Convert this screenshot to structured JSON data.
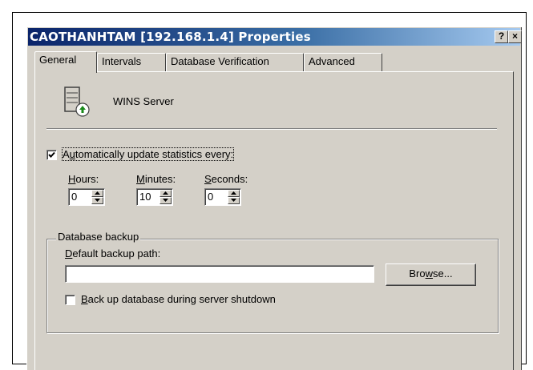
{
  "window": {
    "title": "CAOTHANHTAM [192.168.1.4] Properties",
    "help_button": "?",
    "close_button": "×"
  },
  "tabs": [
    {
      "label": "General",
      "active": true
    },
    {
      "label": "Intervals",
      "active": false
    },
    {
      "label": "Database Verification",
      "active": false
    },
    {
      "label": "Advanced",
      "active": false
    }
  ],
  "general": {
    "server_label": "WINS Server",
    "server_icon": "server-icon",
    "auto_update": {
      "checked": true,
      "label_pre": "A",
      "label_accel": "u",
      "label_post": "tomatically update statistics every:"
    },
    "hours": {
      "accel": "H",
      "rest": "ours:",
      "value": "0"
    },
    "minutes": {
      "accel": "M",
      "rest": "inutes:",
      "value": "10"
    },
    "seconds": {
      "accel": "S",
      "rest": "econds:",
      "value": "0"
    }
  },
  "database_backup": {
    "group_label": "Database backup",
    "path_label_accel": "D",
    "path_label_rest": "efault backup path:",
    "path_value": "",
    "browse_pre": "Bro",
    "browse_accel": "w",
    "browse_post": "se...",
    "shutdown_checkbox": {
      "checked": false,
      "accel": "B",
      "rest": "ack up database during server shutdown"
    }
  }
}
